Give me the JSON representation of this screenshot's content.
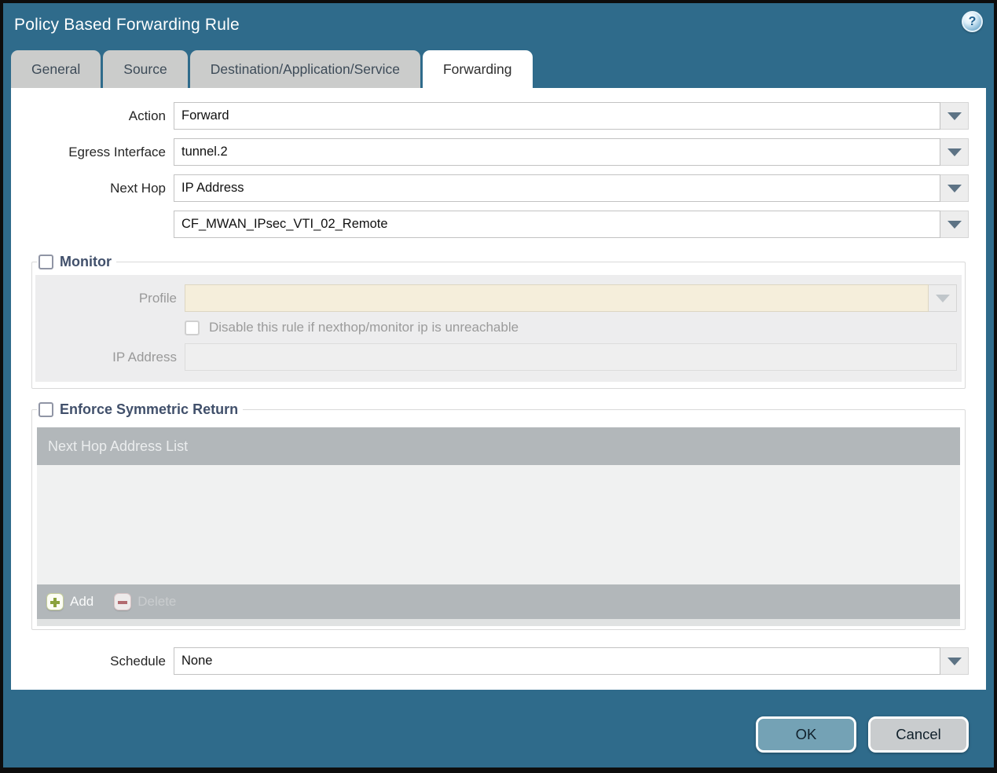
{
  "dialog": {
    "title": "Policy Based Forwarding Rule",
    "help_glyph": "?",
    "accent_color": "#2f6b8b"
  },
  "tabs": [
    {
      "label": "General",
      "active": false
    },
    {
      "label": "Source",
      "active": false
    },
    {
      "label": "Destination/Application/Service",
      "active": false
    },
    {
      "label": "Forwarding",
      "active": true
    }
  ],
  "form": {
    "action": {
      "label": "Action",
      "value": "Forward"
    },
    "egress_interface": {
      "label": "Egress Interface",
      "value": "tunnel.2"
    },
    "next_hop": {
      "label": "Next Hop",
      "value": "IP Address"
    },
    "next_hop_address": {
      "value": "CF_MWAN_IPsec_VTI_02_Remote"
    },
    "schedule": {
      "label": "Schedule",
      "value": "None"
    }
  },
  "monitor": {
    "legend": "Monitor",
    "checked": false,
    "profile": {
      "label": "Profile",
      "value": ""
    },
    "disable_rule": {
      "label": "Disable this rule if nexthop/monitor ip is unreachable",
      "checked": false
    },
    "ip_address": {
      "label": "IP Address",
      "value": ""
    }
  },
  "enforce_symmetric_return": {
    "legend": "Enforce Symmetric Return",
    "checked": false,
    "table": {
      "header": "Next Hop Address List",
      "rows": []
    },
    "add_label": "Add",
    "delete_label": "Delete"
  },
  "footer": {
    "ok_label": "OK",
    "cancel_label": "Cancel"
  }
}
